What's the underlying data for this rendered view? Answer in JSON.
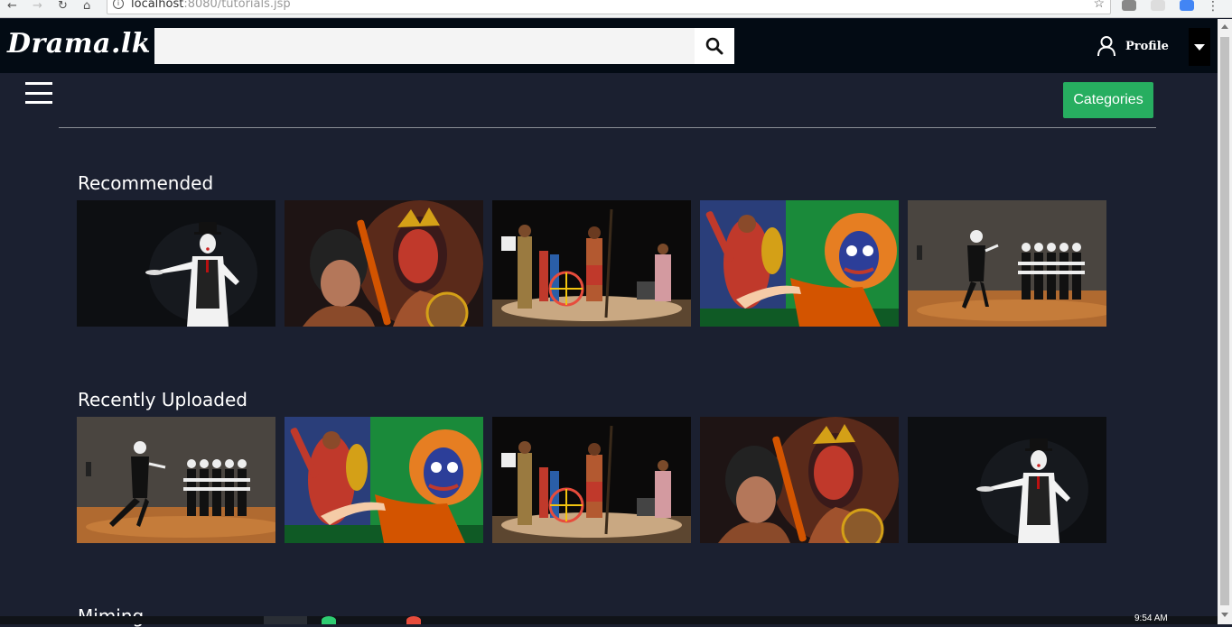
{
  "browser": {
    "url_host": "localhost",
    "url_rest": ":8080/tutorials.jsp"
  },
  "header": {
    "logo": "Drama.lk",
    "search_placeholder": "",
    "profile_label": "Profile"
  },
  "toolbar": {
    "categories_label": "Categories"
  },
  "sections": [
    {
      "title": "Recommended",
      "thumbnails": [
        "mime-performer",
        "kolam-dancers-closeup",
        "stage-drama-cast",
        "kolam-mask-green",
        "mime-troupe-stage"
      ]
    },
    {
      "title": "Recently Uploaded",
      "thumbnails": [
        "mime-troupe-stage",
        "kolam-mask-green",
        "stage-drama-cast",
        "kolam-dancers-closeup",
        "mime-performer"
      ]
    },
    {
      "title": "Miming",
      "thumbnails": []
    }
  ],
  "colors": {
    "background": "#1b2030",
    "topbar": "#030b14",
    "accent_green": "#27ae60"
  },
  "taskbar": {
    "clock": "9:54 AM"
  }
}
